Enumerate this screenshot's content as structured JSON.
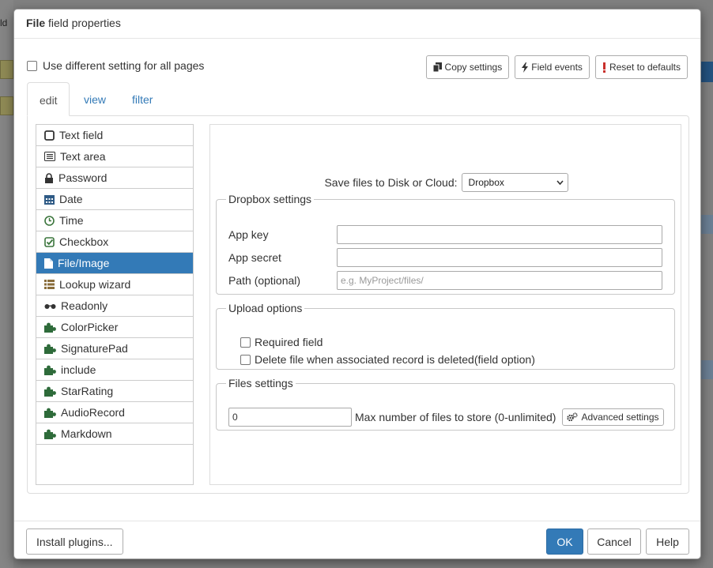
{
  "background": {
    "left_text": "ld"
  },
  "dialog": {
    "title_bold": "File",
    "title_rest": "field properties",
    "use_different_label": "Use different setting for all pages",
    "buttons": {
      "copy_settings": "Copy settings",
      "field_events": "Field events",
      "reset_defaults": "Reset to defaults"
    },
    "tabs": [
      {
        "label": "edit",
        "active": true
      },
      {
        "label": "view",
        "active": false
      },
      {
        "label": "filter",
        "active": false
      }
    ],
    "edit_types": [
      {
        "label": "Text field",
        "icon": "text-field-icon"
      },
      {
        "label": "Text area",
        "icon": "text-area-icon"
      },
      {
        "label": "Password",
        "icon": "lock-icon"
      },
      {
        "label": "Date",
        "icon": "calendar-icon"
      },
      {
        "label": "Time",
        "icon": "clock-icon"
      },
      {
        "label": "Checkbox",
        "icon": "checkbox-icon"
      },
      {
        "label": "File/Image",
        "icon": "file-icon",
        "active": true
      },
      {
        "label": "Lookup wizard",
        "icon": "list-icon"
      },
      {
        "label": "Readonly",
        "icon": "glasses-icon"
      },
      {
        "label": "ColorPicker",
        "icon": "puzzle-icon"
      },
      {
        "label": "SignaturePad",
        "icon": "puzzle-icon"
      },
      {
        "label": "include",
        "icon": "puzzle-icon"
      },
      {
        "label": "StarRating",
        "icon": "puzzle-icon"
      },
      {
        "label": "AudioRecord",
        "icon": "puzzle-icon"
      },
      {
        "label": "Markdown",
        "icon": "puzzle-icon"
      }
    ],
    "save_to_label": "Save files to Disk or Cloud:",
    "save_to_value": "Dropbox",
    "dropbox": {
      "legend": "Dropbox settings",
      "app_key_label": "App key",
      "app_key_value": "",
      "app_secret_label": "App secret",
      "app_secret_value": "",
      "path_label": "Path (optional)",
      "path_placeholder": "e.g. MyProject/files/"
    },
    "upload": {
      "legend": "Upload options",
      "required_label": "Required field",
      "delete_label": "Delete file when associated record is deleted(field option)"
    },
    "files": {
      "legend": "Files settings",
      "max_value": "0",
      "max_label": "Max number of files to store (0-unlimited)",
      "advanced_label": "Advanced settings"
    },
    "footer": {
      "install_plugins": "Install plugins...",
      "ok": "OK",
      "cancel": "Cancel",
      "help": "Help"
    }
  },
  "colors": {
    "accent": "#337ab7",
    "icon_green": "#3c763d",
    "puzzle_green": "#2e6b3a",
    "reset_red": "#c9302c"
  }
}
